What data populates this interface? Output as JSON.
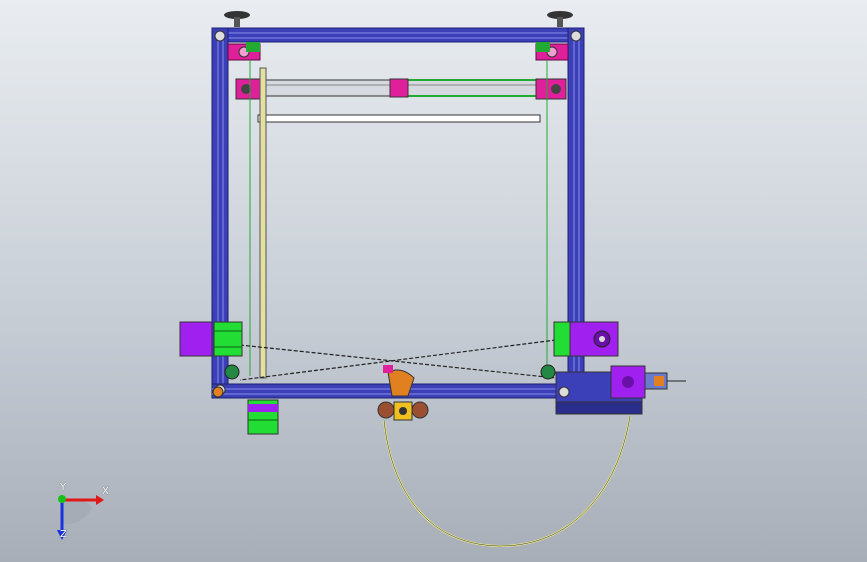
{
  "viewport": {
    "background_top": "#e9edf1",
    "background_bottom": "#a7aeb8"
  },
  "colors": {
    "frame": "#3b3fb8",
    "frame_dark": "#2a2d8c",
    "motor": "#a020f0",
    "motor_green": "#22dd33",
    "bracket_magenta": "#e0209a",
    "rail": "#22aa33",
    "belt": "#222222",
    "filament": "#e6e68a",
    "hotend_orange": "#e08020"
  },
  "triad": {
    "x_label": "X",
    "y_label": "Y",
    "z_label": "Z",
    "x_color": "#e01818",
    "y_color": "#16c016",
    "z_color": "#1830e0"
  }
}
